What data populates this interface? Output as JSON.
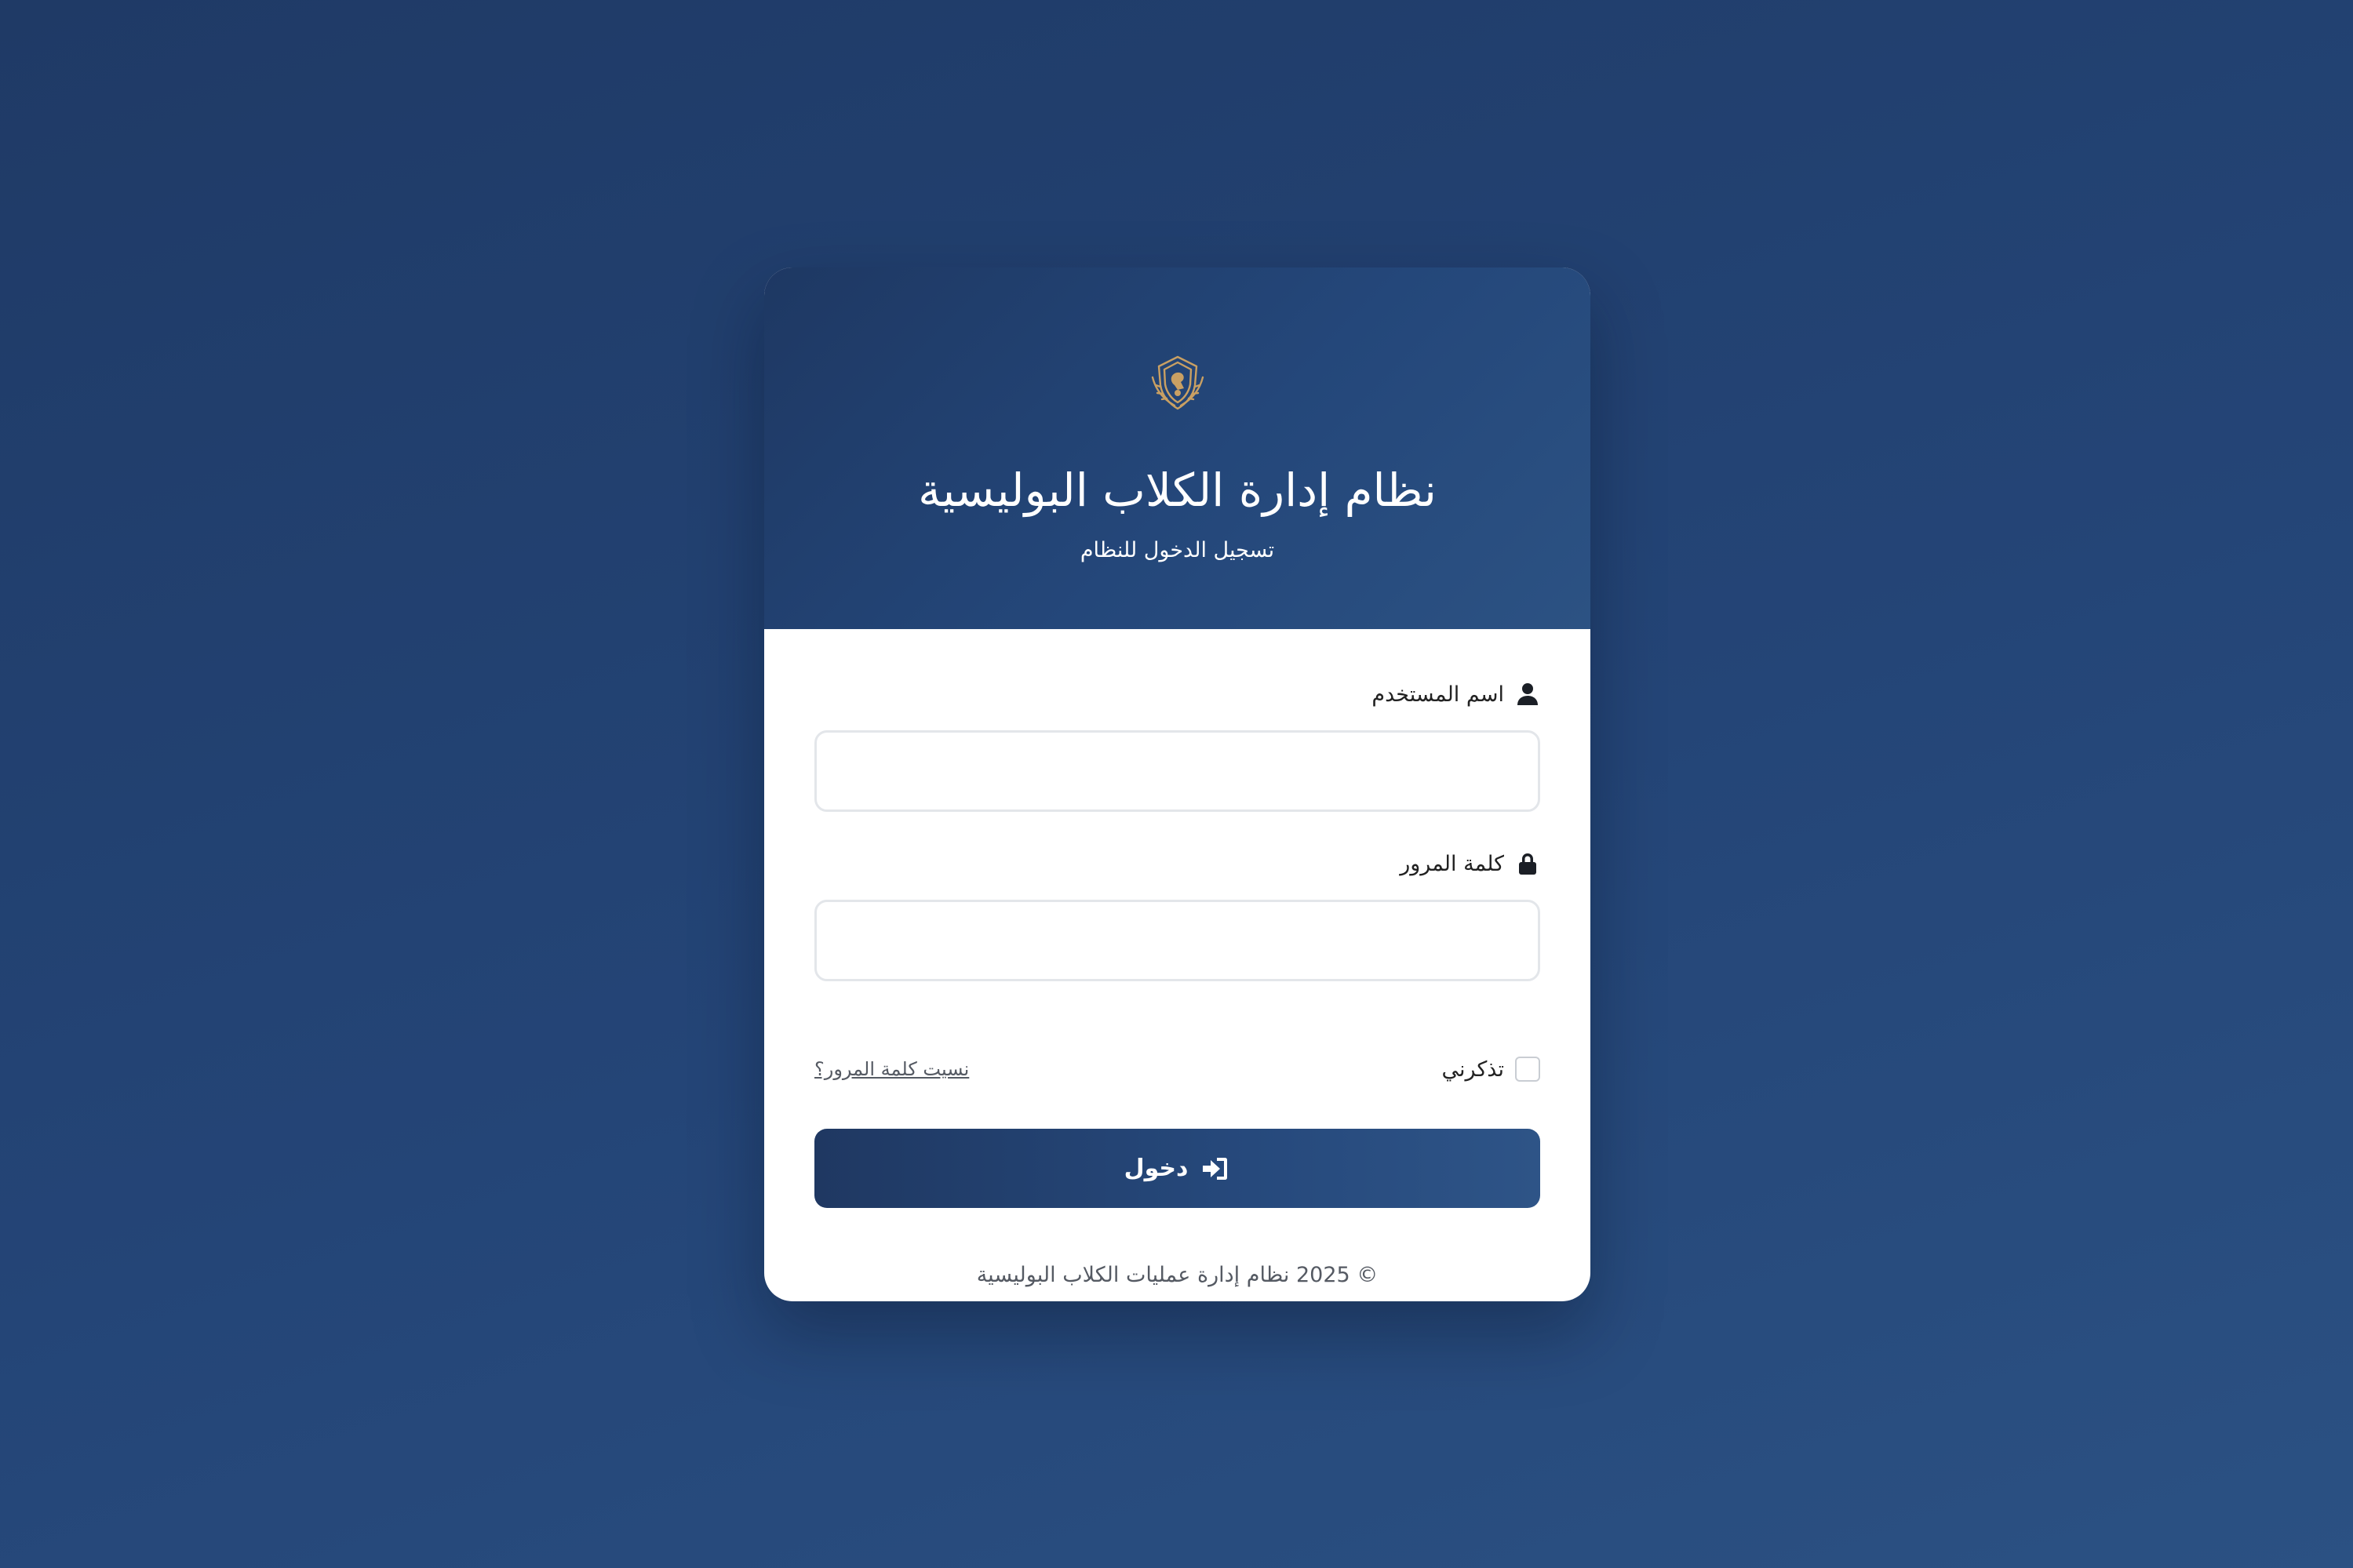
{
  "header": {
    "title": "نظام إدارة الكلاب البوليسية",
    "subtitle": "تسجيل الدخول للنظام",
    "emblem_icon": "police-shield-emblem-icon"
  },
  "form": {
    "username": {
      "label": "اسم المستخدم",
      "icon": "user-icon",
      "value": "",
      "placeholder": ""
    },
    "password": {
      "label": "كلمة المرور",
      "icon": "lock-icon",
      "value": "",
      "placeholder": ""
    },
    "remember_label": "تذكرني",
    "remember_checked": false,
    "forgot_link": "نسيت كلمة المرور؟",
    "submit_label": "دخول",
    "submit_icon": "sign-in-icon"
  },
  "footer": {
    "copyright": "© 2025 نظام إدارة عمليات الكلاب البوليسية"
  },
  "colors": {
    "background": "#244577",
    "header_gradient_start": "#1e3863",
    "header_gradient_end": "#2c5283",
    "emblem_gold": "#c9a063",
    "button": "#26497c"
  }
}
